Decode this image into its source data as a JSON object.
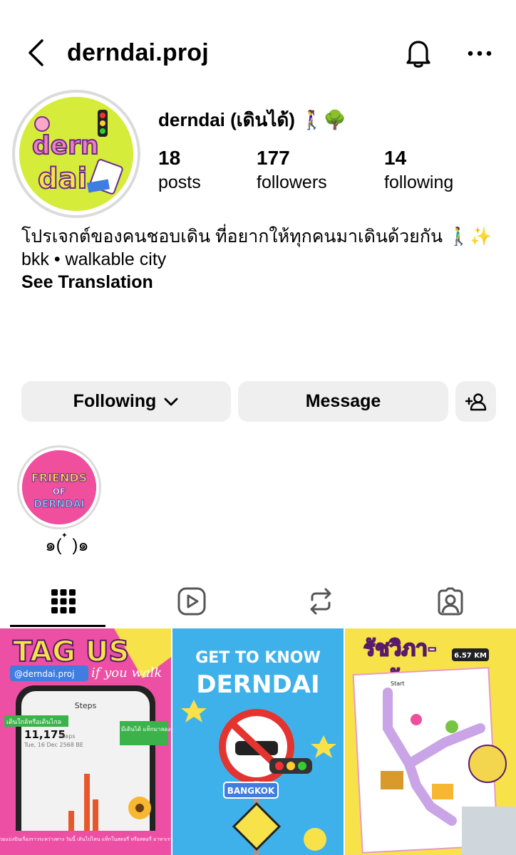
{
  "header": {
    "username": "derndai.proj",
    "back_icon": "chevron-left-icon",
    "notification_icon": "bell-icon",
    "more_icon": "more-horizontal-icon"
  },
  "profile": {
    "display_name": "derndai (เดินได้) 🚶‍♀️🌳",
    "avatar_text": "dern dai",
    "stats": {
      "posts": {
        "value": "18",
        "label": "posts"
      },
      "followers": {
        "value": "177",
        "label": "followers"
      },
      "following": {
        "value": "14",
        "label": "following"
      }
    },
    "bio": {
      "line1": "โปรเจกต์ของคนชอบเดิน ที่อยากให้ทุกคนมาเดินด้วยกัน 🚶‍♂️✨",
      "line2": "bkk • walkable city"
    },
    "see_translation": "See Translation"
  },
  "actions": {
    "following_label": "Following",
    "message_label": "Message"
  },
  "highlights": [
    {
      "label": "๑( ๋ )๑",
      "image_text_1": "FRIENDS",
      "image_text_2": "OF",
      "image_text_3": "DERNDAI"
    }
  ],
  "tabs": [
    {
      "name": "posts-grid",
      "icon": "grid-icon",
      "active": true
    },
    {
      "name": "reels",
      "icon": "reels-icon",
      "active": false
    },
    {
      "name": "reposts",
      "icon": "repost-icon",
      "active": false
    },
    {
      "name": "tagged",
      "icon": "tagged-icon",
      "active": false
    }
  ],
  "posts": [
    {
      "title": "TAG US",
      "subtitle": "if you walk",
      "handle": "@derndai.proj",
      "steps_label": "Steps",
      "steps_value": "11,175",
      "steps_unit": "steps",
      "date": "Tue, 16 Dec 2568 BE",
      "tag1": "เดินใกล้หรือเดินไกล",
      "tag2": "มีเดินได้ แท็กมาลองดูเรา",
      "footer": "\"เดินได้\" ชวนคุณมาร่วมแบ่งปันเรื่องราวระหว่างทาง วันนี้ เดินไปไหน แท็กในสตอรี่ หรือสตอรี่ มาหาเราได้ที่ @derndai.proj"
    },
    {
      "line1": "GET TO KNOW",
      "line2": "DERNDAI",
      "sign": "BANGKOK"
    },
    {
      "title_line1": "รัชวิภา-",
      "title_line2": "รัชดา",
      "distance": "6.57 KM",
      "start": "Start"
    }
  ],
  "colors": {
    "button_bg": "#efefef",
    "ring": "#dbdbdb",
    "post1_bg": "#ec4fa3",
    "post2_bg": "#3fb1ea",
    "post3_bg": "#f7e24a",
    "avatar_bg": "#d6ec3a"
  }
}
